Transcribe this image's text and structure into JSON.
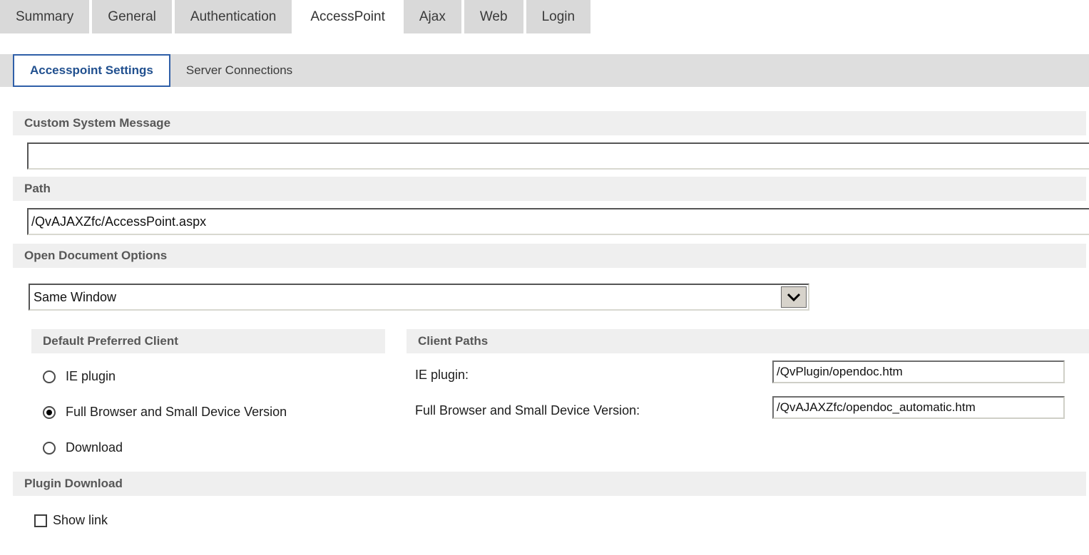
{
  "main_tabs": [
    {
      "label": "Summary",
      "selected": false
    },
    {
      "label": "General",
      "selected": false
    },
    {
      "label": "Authentication",
      "selected": false
    },
    {
      "label": "AccessPoint",
      "selected": true
    },
    {
      "label": "Ajax",
      "selected": false
    },
    {
      "label": "Web",
      "selected": false
    },
    {
      "label": "Login",
      "selected": false
    }
  ],
  "sub_tabs": [
    {
      "label": "Accesspoint Settings",
      "selected": true
    },
    {
      "label": "Server Connections",
      "selected": false
    }
  ],
  "sections": {
    "custom_system_message": {
      "title": "Custom System Message",
      "value": "",
      "placeholder": ""
    },
    "path": {
      "title": "Path",
      "value": "/QvAJAXZfc/AccessPoint.aspx",
      "placeholder": ""
    },
    "open_document_options": {
      "title": "Open Document Options",
      "selected": "Same Window",
      "options": [
        "Same Window"
      ]
    },
    "default_preferred_client": {
      "title": "Default Preferred Client",
      "options": [
        {
          "label": "IE plugin",
          "checked": false
        },
        {
          "label": "Full Browser and Small Device Version",
          "checked": true
        },
        {
          "label": "Download",
          "checked": false
        }
      ]
    },
    "client_paths": {
      "title": "Client Paths",
      "rows": [
        {
          "label": "IE plugin:",
          "value": "/QvPlugin/opendoc.htm"
        },
        {
          "label": "Full Browser and Small Device Version:",
          "value": "/QvAJAXZfc/opendoc_automatic.htm"
        }
      ]
    },
    "plugin_download": {
      "title": "Plugin Download",
      "show_link": {
        "label": "Show link",
        "checked": false
      }
    }
  },
  "icons": {
    "dropdown": "chevron-down-icon"
  },
  "colors": {
    "tab_inactive": "#d9d9d9",
    "tab_active": "#ffffff",
    "subtab_bar": "#dedede",
    "subtab_accent": "#2f5fa8",
    "section_header_bg": "#efefef",
    "section_header_text": "#575757"
  }
}
